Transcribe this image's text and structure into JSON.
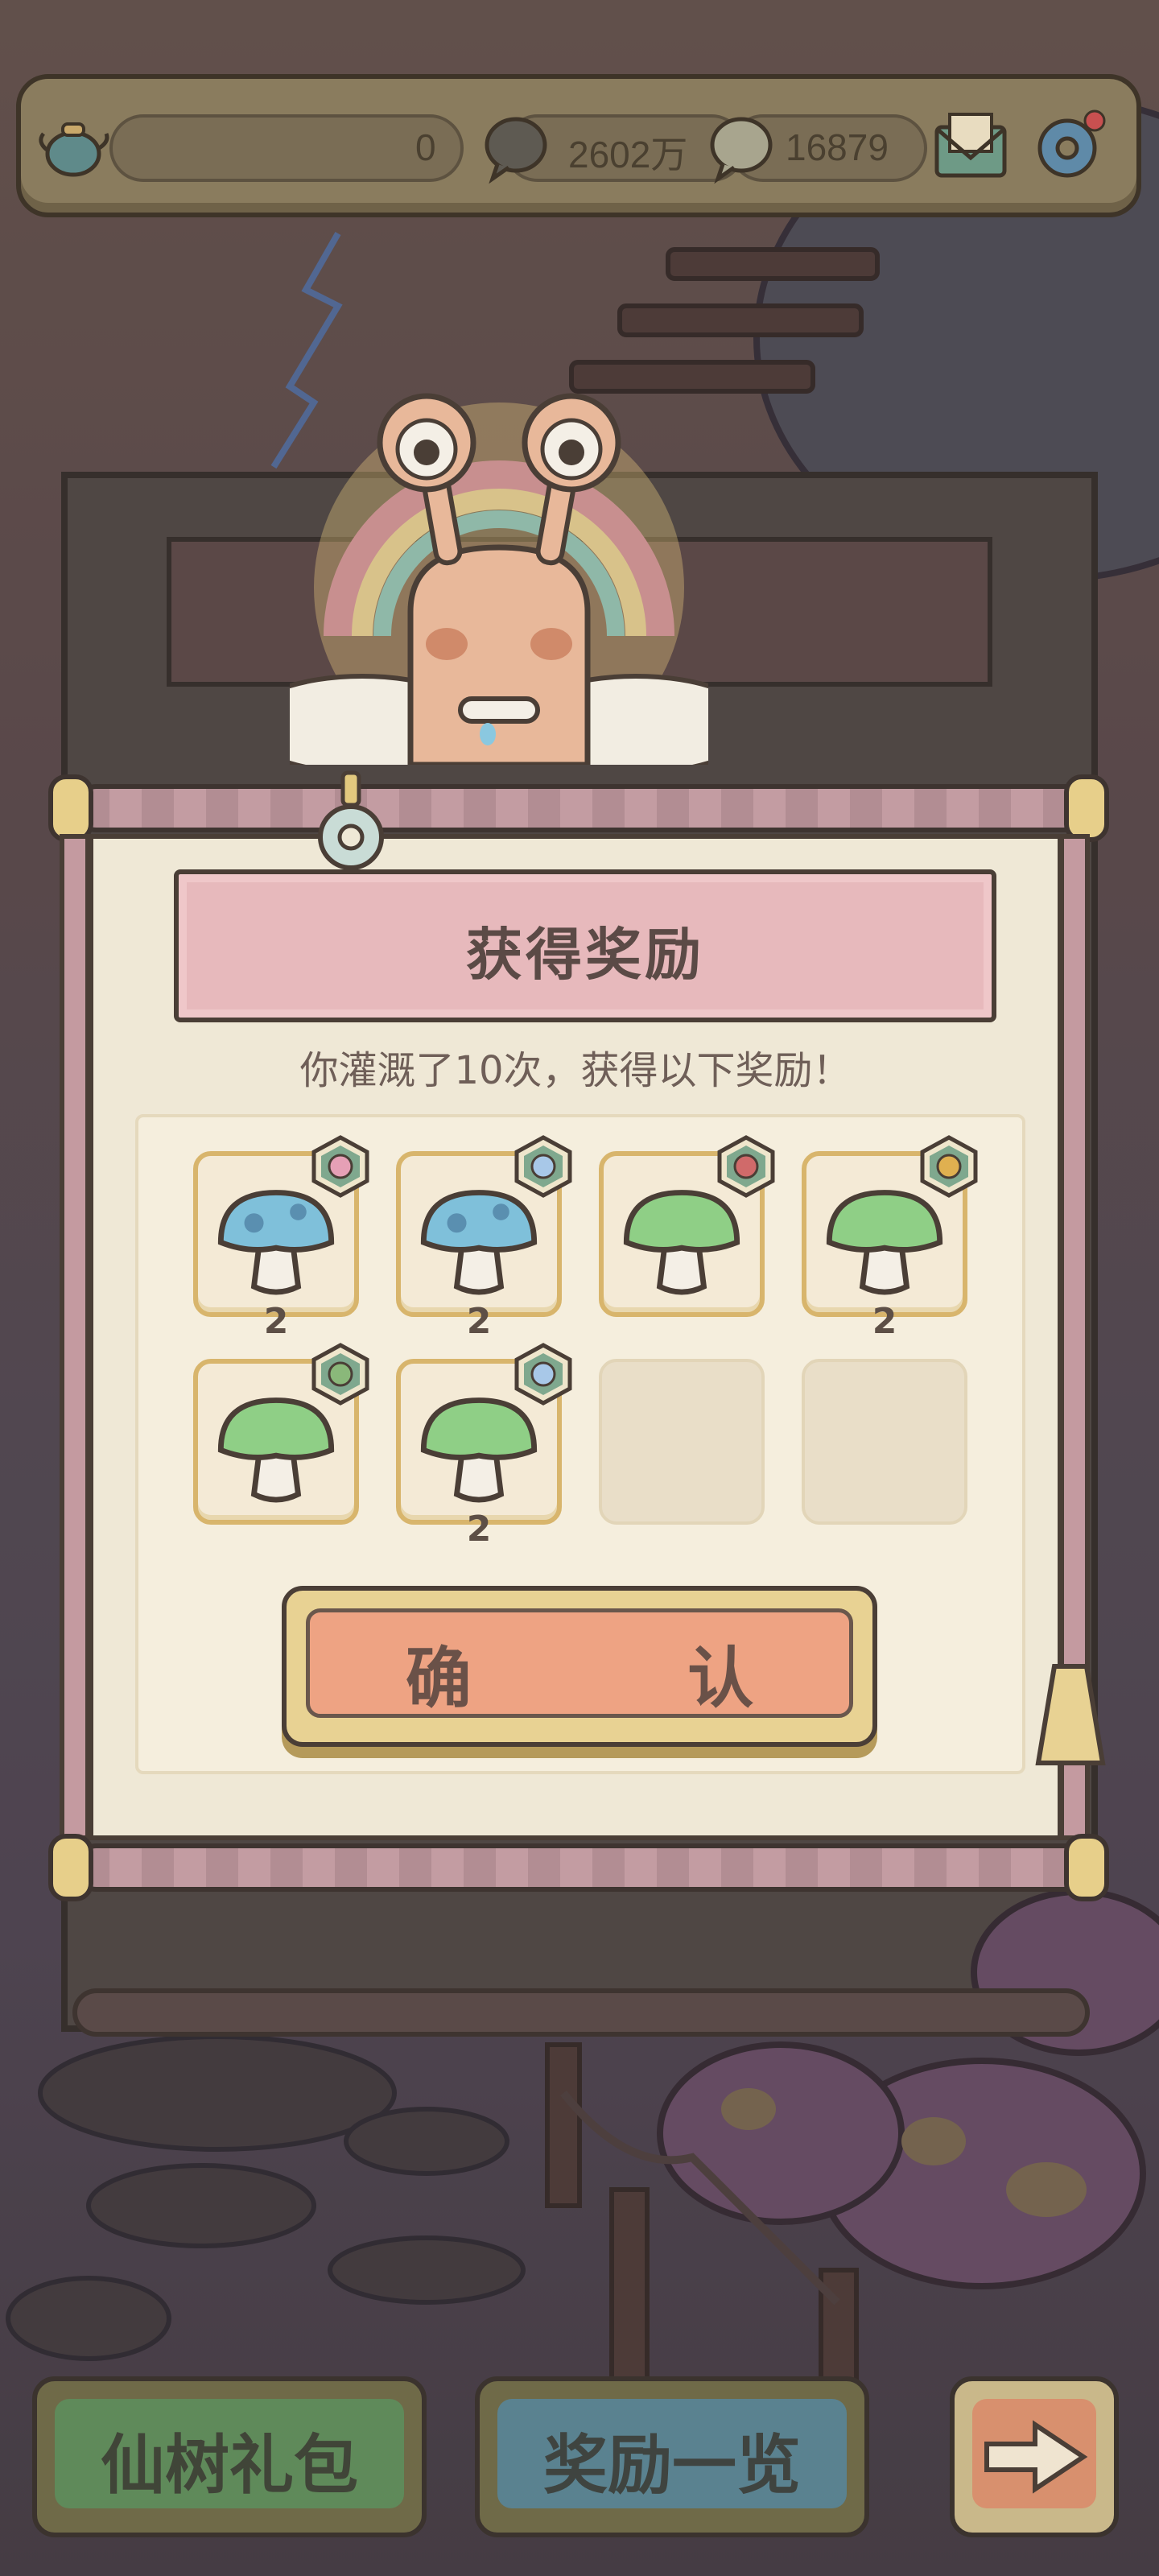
{
  "hud": {
    "bar_value": "0",
    "currency_1": "2602万",
    "currency_2": "16879"
  },
  "dialog": {
    "title": "获得奖励",
    "message": "你灌溉了10次，获得以下奖励！",
    "confirm_label": "确  认"
  },
  "rewards": [
    {
      "item": "blue-mushroom",
      "badge": "flower-icon",
      "count": "2"
    },
    {
      "item": "blue-mushroom",
      "badge": "bandage-icon",
      "count": "2"
    },
    {
      "item": "green-mushroom",
      "badge": "rose-icon",
      "count": ""
    },
    {
      "item": "green-mushroom",
      "badge": "bow-icon",
      "count": "2"
    },
    {
      "item": "green-mushroom",
      "badge": "wing-icon",
      "count": ""
    },
    {
      "item": "green-mushroom",
      "badge": "bandage-icon",
      "count": "2"
    },
    {
      "item": "",
      "badge": "",
      "count": ""
    },
    {
      "item": "",
      "badge": "",
      "count": ""
    }
  ],
  "bottom": {
    "gift_label": "仙树礼包",
    "rewards_label": "奖励一览"
  },
  "colors": {
    "title_board": "#e7b9bc",
    "confirm": "#eea383",
    "gift_button": "#5f8a5a",
    "rewards_button": "#5a8290",
    "arrow_button": "#f0a078"
  }
}
